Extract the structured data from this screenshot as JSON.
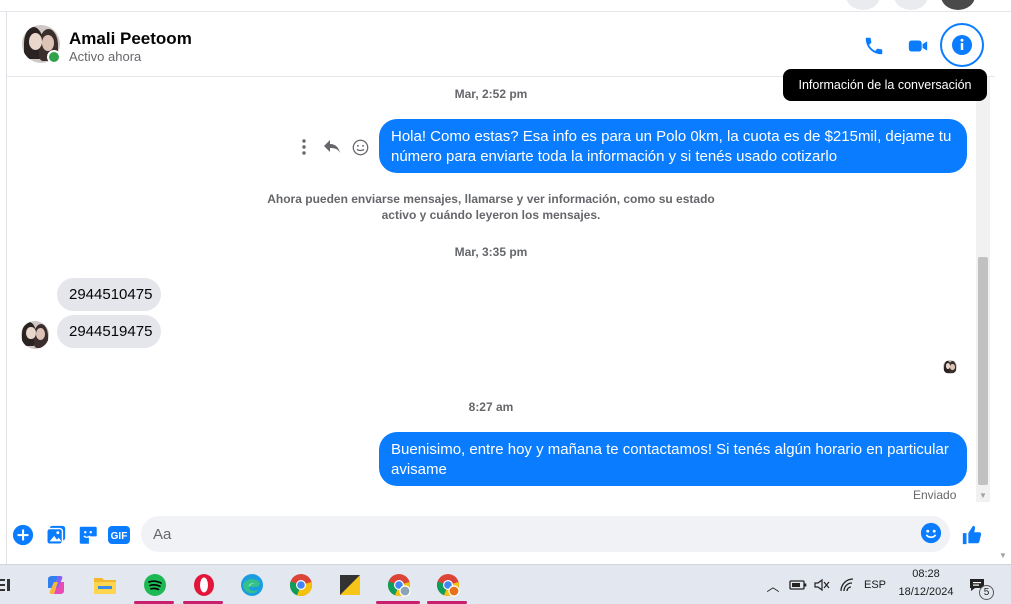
{
  "header": {
    "contact_name": "Amali Peetoom",
    "status": "Activo ahora",
    "tooltip": "Información de la conversación",
    "icons": [
      "phone-icon",
      "video-icon",
      "info-icon"
    ]
  },
  "messages": {
    "stamp1": "Mar, 2:52 pm",
    "msg1": "Hola! Como estas? Esa info es para un Polo 0km, la cuota es de $215mil, dejame tu número para enviarte toda la información y si tenés usado cotizarlo",
    "system_note": "Ahora pueden enviarse mensajes, llamarse y ver información, como su estado activo y cuándo leyeron los mensajes.",
    "stamp2": "Mar, 3:35 pm",
    "in1": "2944510475",
    "in2": "2944519475",
    "stamp3": "8:27 am",
    "msg2": "Buenisimo, entre hoy y mañana te contactamos! Si tenés algún horario en particular avisame",
    "sent_label": "Enviado"
  },
  "composer": {
    "placeholder": "Aa",
    "icons": [
      "add-icon",
      "gallery-icon",
      "sticker-icon",
      "gif-icon",
      "emoji-icon",
      "like-icon"
    ],
    "gif_label": "GIF"
  },
  "taskbar": {
    "apps": [
      "copilot-icon",
      "file-explorer-icon",
      "spotify-icon",
      "opera-icon",
      "edge-icon",
      "chrome-icon",
      "sticky-notes-icon",
      "chrome-profile-icon",
      "chrome-profile-2-icon"
    ],
    "language": "ESP",
    "time": "08:28",
    "date": "18/12/2024",
    "notification_count": "5",
    "colors": {
      "accent": "#0a7cff",
      "underline": "#c8206e"
    }
  }
}
